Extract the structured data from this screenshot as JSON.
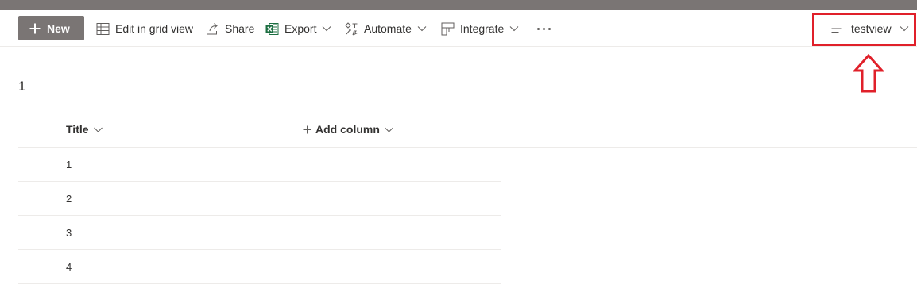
{
  "commandbar": {
    "new_label": "New",
    "edit_grid_label": "Edit in grid view",
    "share_label": "Share",
    "export_label": "Export",
    "automate_label": "Automate",
    "integrate_label": "Integrate"
  },
  "view_selector": {
    "label": "testview"
  },
  "list": {
    "title": "1",
    "columns": [
      "Title",
      "Add column"
    ],
    "rows": [
      {
        "title": "1"
      },
      {
        "title": "2"
      },
      {
        "title": "3"
      },
      {
        "title": "4"
      }
    ]
  },
  "colors": {
    "topbar": "#7a7574",
    "new_button": "#7a7574",
    "annotation": "#e0202a",
    "excel_green": "#1d6f42"
  }
}
